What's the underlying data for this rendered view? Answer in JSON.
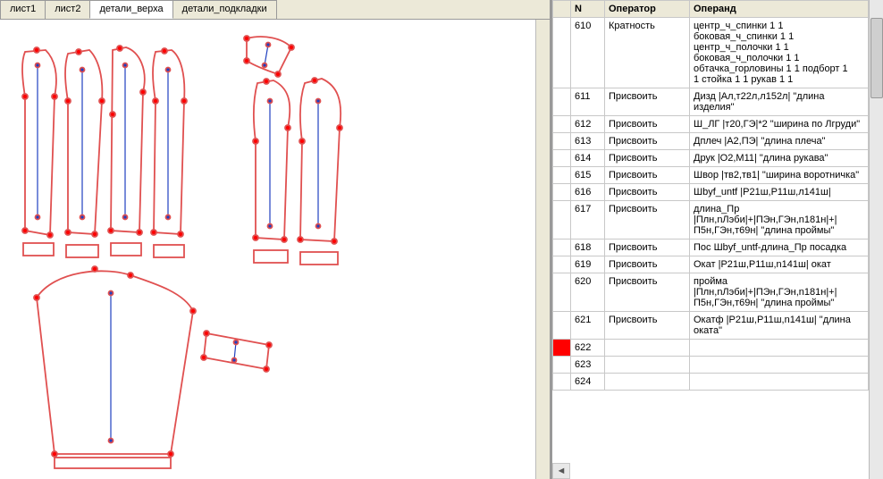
{
  "tabs": [
    "лист1",
    "лист2",
    "детали_верха",
    "детали_подкладки"
  ],
  "active_tab": 2,
  "table": {
    "header": {
      "n": "N",
      "operator": "Оператор",
      "operand": "Операнд"
    },
    "rows": [
      {
        "n": "610",
        "op": "Кратность",
        "arg": "центр_ч_спинки 1 1\nбоковая_ч_спинки 1 1\nцентр_ч_полочки 1 1\nбоковая_ч_полочки 1 1\nобтачка_горловины 1 1 подборт 1\n1 стойка 1 1 рукав 1 1"
      },
      {
        "n": "611",
        "op": "Присвоить",
        "arg": "Дизд |Ал,т22л,л152л| \"длина изделия\""
      },
      {
        "n": "612",
        "op": "Присвоить",
        "arg": "Ш_ЛГ |т20,ГЭ|*2 \"ширина по Лгруди\""
      },
      {
        "n": "613",
        "op": "Присвоить",
        "arg": "Дплеч |А2,ПЭ| \"длина плеча\""
      },
      {
        "n": "614",
        "op": "Присвоить",
        "arg": "Друк |О2,М11| \"длина рукава\""
      },
      {
        "n": "615",
        "op": "Присвоить",
        "arg": "Швор |тв2,тв1| \"ширина воротничка\""
      },
      {
        "n": "616",
        "op": "Присвоить",
        "arg": "Шbуf_untf |Р21ш,Р11ш,л141ш|"
      },
      {
        "n": "617",
        "op": "Присвоить",
        "arg": "длина_Пр\n|Плн,nЛэби|+|ПЭн,ГЭн,n181н|+|\nП5н,ГЭн,т69н| \"длина проймы\""
      },
      {
        "n": "618",
        "op": "Присвоить",
        "arg": "Пос Шbуf_untf-длина_Пр посадка"
      },
      {
        "n": "619",
        "op": "Присвоить",
        "arg": "Окат |Р21ш,Р11ш,n141ш| окат"
      },
      {
        "n": "620",
        "op": "Присвоить",
        "arg": "пройма\n|Плн,nЛэби|+|ПЭн,ГЭн,n181н|+|\nП5н,ГЭн,т69н| \"длина проймы\""
      },
      {
        "n": "621",
        "op": "Присвоить",
        "arg": "Окатф |Р21ш,Р11ш,n141ш| \"длина оката\""
      },
      {
        "n": "622",
        "op": "",
        "arg": "",
        "marker": true
      },
      {
        "n": "623",
        "op": "",
        "arg": ""
      },
      {
        "n": "624",
        "op": "",
        "arg": ""
      }
    ],
    "arrow": "◄"
  }
}
